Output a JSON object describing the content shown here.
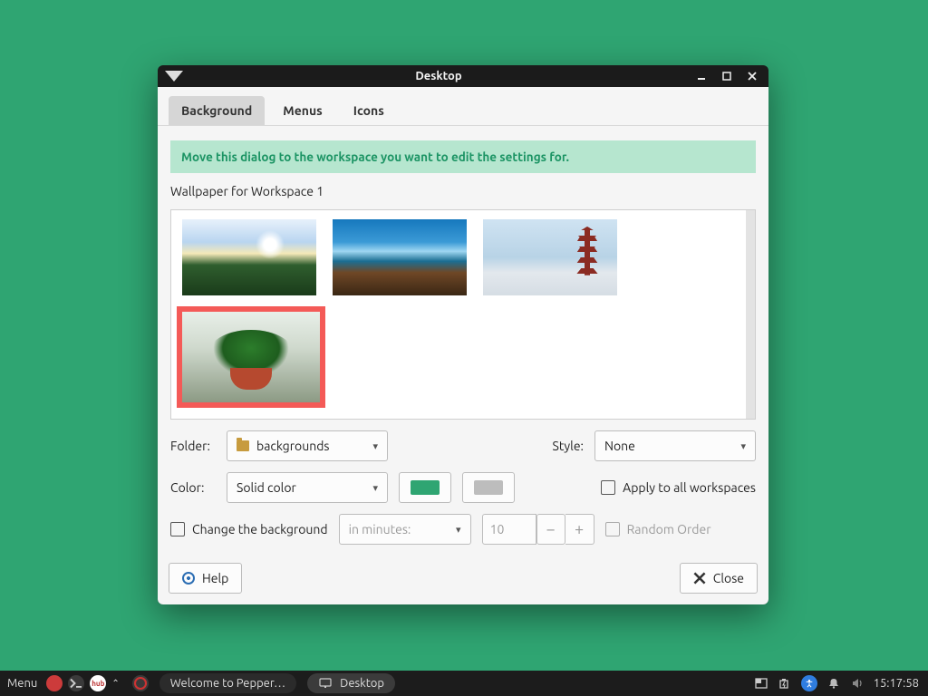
{
  "window": {
    "title": "Desktop",
    "tabs": {
      "background": "Background",
      "menus": "Menus",
      "icons": "Icons"
    },
    "banner": "Move this dialog to the workspace you want to edit the settings for.",
    "sectionLabel": "Wallpaper for Workspace 1",
    "folder": {
      "label": "Folder:",
      "value": "backgrounds"
    },
    "style": {
      "label": "Style:",
      "value": "None"
    },
    "color": {
      "label": "Color:",
      "value": "Solid color",
      "primary": "#2fa572",
      "secondary": "#bdbdbd"
    },
    "applyAll": {
      "label": "Apply to all workspaces",
      "checked": false
    },
    "changeBg": {
      "label": "Change the background",
      "checked": false,
      "periodLabel": "in minutes:",
      "value": "10",
      "randomLabel": "Random Order",
      "randomChecked": false
    },
    "buttons": {
      "help": "Help",
      "close": "Close"
    }
  },
  "taskbar": {
    "menu": "Menu",
    "task1": "Welcome to Pepper…",
    "task2": "Desktop",
    "clock": "15:17:58"
  }
}
